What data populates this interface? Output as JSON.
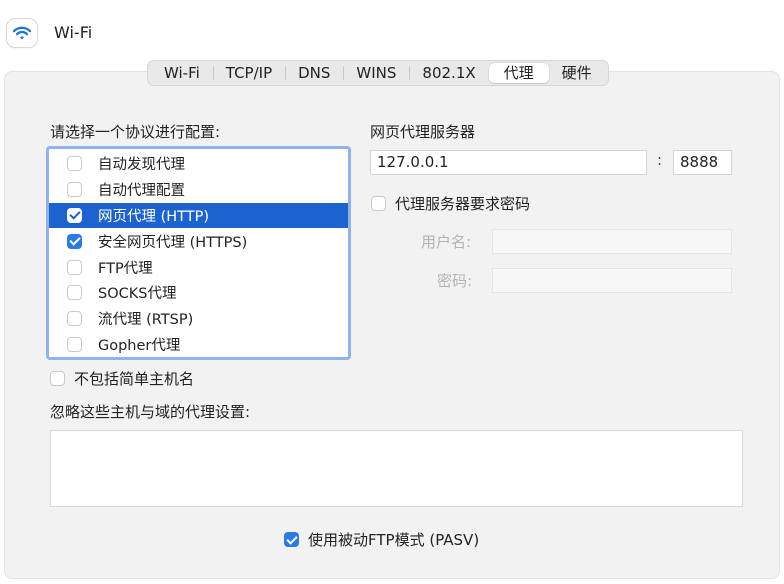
{
  "header": {
    "title": "Wi-Fi",
    "icon": "wifi-icon"
  },
  "tabs": [
    {
      "label": "Wi-Fi",
      "active": false
    },
    {
      "label": "TCP/IP",
      "active": false
    },
    {
      "label": "DNS",
      "active": false
    },
    {
      "label": "WINS",
      "active": false
    },
    {
      "label": "802.1X",
      "active": false
    },
    {
      "label": "代理",
      "active": true
    },
    {
      "label": "硬件",
      "active": false
    }
  ],
  "protocols": {
    "label": "请选择一个协议进行配置:",
    "items": [
      {
        "label": "自动发现代理",
        "checked": false,
        "selected": false
      },
      {
        "label": "自动代理配置",
        "checked": false,
        "selected": false
      },
      {
        "label": "网页代理 (HTTP)",
        "checked": true,
        "selected": true
      },
      {
        "label": "安全网页代理 (HTTPS)",
        "checked": true,
        "selected": false
      },
      {
        "label": "FTP代理",
        "checked": false,
        "selected": false
      },
      {
        "label": "SOCKS代理",
        "checked": false,
        "selected": false
      },
      {
        "label": "流代理 (RTSP)",
        "checked": false,
        "selected": false
      },
      {
        "label": "Gopher代理",
        "checked": false,
        "selected": false
      }
    ]
  },
  "proxy_server": {
    "label": "网页代理服务器",
    "host": "127.0.0.1",
    "colon": ":",
    "port": "8888",
    "requires_password_label": "代理服务器要求密码",
    "requires_password": false,
    "username_label": "用户名:",
    "username": "",
    "password_label": "密码:",
    "password": ""
  },
  "exclude_simple_hostnames": {
    "label": "不包括简单主机名",
    "checked": false
  },
  "bypass": {
    "label": "忽略这些主机与域的代理设置:",
    "value": ""
  },
  "passive_ftp": {
    "label": "使用被动FTP模式 (PASV)",
    "checked": true
  },
  "colors": {
    "accent": "#2a7ae8",
    "selection": "#1d63cf",
    "list_focus_ring": "#8fb3ec"
  }
}
